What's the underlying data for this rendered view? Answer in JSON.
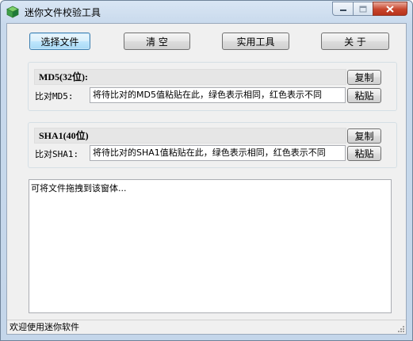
{
  "window": {
    "title": "迷你文件校验工具"
  },
  "toolbar": {
    "select_file": "选择文件",
    "clear": "清  空",
    "tools": "实用工具",
    "about": "关  于"
  },
  "md5": {
    "title": "MD5(32位):",
    "copy": "复制",
    "compare_label": "比对MD5:",
    "compare_value": "将待比对的MD5值粘贴在此，绿色表示相同，红色表示不同",
    "paste": "粘贴"
  },
  "sha1": {
    "title": "SHA1(40位)",
    "copy": "复制",
    "compare_label": "比对SHA1:",
    "compare_value": "将待比对的SHA1值粘贴在此，绿色表示相同，红色表示不同",
    "paste": "粘贴"
  },
  "drop_area": {
    "hint": "可将文件拖拽到该窗体..."
  },
  "status": {
    "text": "欢迎使用迷你软件"
  },
  "colors": {
    "close_button": "#c7452c",
    "focus_border": "#3c7fb1"
  },
  "icons": {
    "app": "cube-icon",
    "minimize": "minimize-icon",
    "maximize": "maximize-icon",
    "close": "close-icon"
  }
}
